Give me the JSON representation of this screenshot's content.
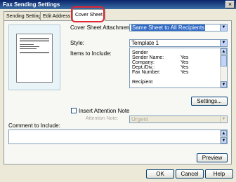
{
  "window": {
    "title": "Fax Sending Settings",
    "close_glyph": "×"
  },
  "tabs": [
    {
      "label": "Sending Settings"
    },
    {
      "label": "Edit Address Book"
    },
    {
      "label": "Cover Sheet"
    }
  ],
  "attachment": {
    "label": "Cover Sheet Attachment:",
    "value": "Same Sheet to All Recipients"
  },
  "style": {
    "label": "Style:",
    "value": "Template 1"
  },
  "items": {
    "label": "Items to Include:",
    "rows": [
      {
        "name": "Sender",
        "value": ""
      },
      {
        "name": "Sender Name:",
        "value": "Yes"
      },
      {
        "name": "Company:",
        "value": "Yes"
      },
      {
        "name": "Dept./Div.:",
        "value": "Yes"
      },
      {
        "name": "Fax Number:",
        "value": "Yes"
      },
      {
        "name": "",
        "value": ""
      },
      {
        "name": "Recipient",
        "value": ""
      }
    ]
  },
  "settings_button": "Settings...",
  "attention": {
    "checkbox_label": "Insert Attention Note",
    "note_label": "Attention Note:",
    "note_value": "Urgent"
  },
  "comment": {
    "label": "Comment to Include:",
    "value": ""
  },
  "preview_button": "Preview",
  "footer": {
    "ok": "OK",
    "cancel": "Cancel",
    "help": "Help"
  },
  "colors": {
    "highlight": "#e0262f",
    "selection": "#316ac5"
  }
}
